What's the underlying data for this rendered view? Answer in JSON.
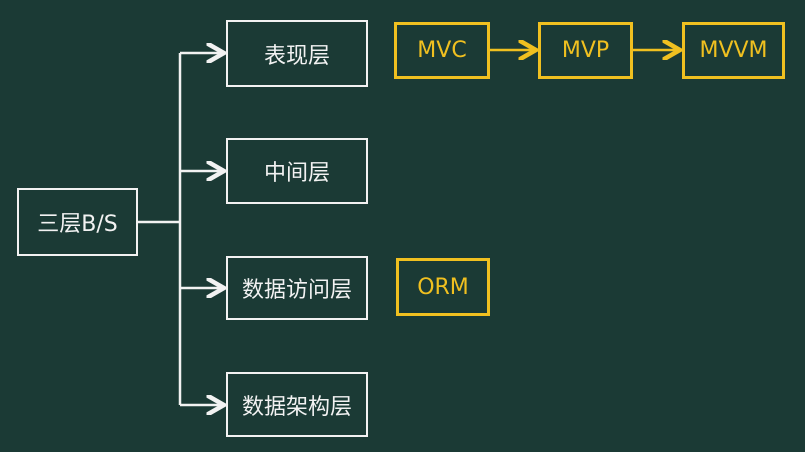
{
  "root": "三层B/S",
  "layers": [
    "表现层",
    "中间层",
    "数据访问层",
    "数据架构层"
  ],
  "patterns": [
    "MVC",
    "MVP",
    "MVVM"
  ],
  "orm": "ORM",
  "colors": {
    "background": "#1b3a35",
    "line": "#f2f2f2",
    "highlight": "#f0c020"
  }
}
